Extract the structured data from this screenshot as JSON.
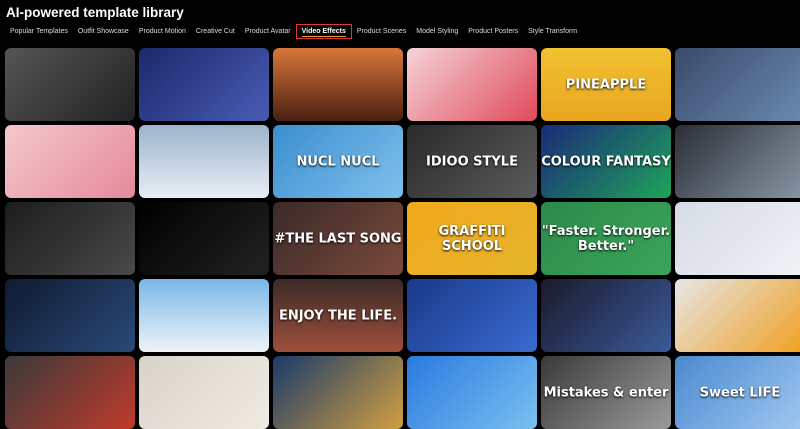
{
  "header": {
    "title": "AI-powered template library"
  },
  "tabs": [
    {
      "label": "Popular Templates"
    },
    {
      "label": "Outfit Showcase"
    },
    {
      "label": "Product Motion"
    },
    {
      "label": "Creative Cut"
    },
    {
      "label": "Product Avatar"
    },
    {
      "label": "Video Effects",
      "active": true
    },
    {
      "label": "Product Scenes"
    },
    {
      "label": "Model Styling"
    },
    {
      "label": "Product Posters"
    },
    {
      "label": "Style Transform"
    }
  ],
  "cards": [
    {
      "bg": "linear-gradient(135deg,#555,#222)",
      "text": ""
    },
    {
      "bg": "linear-gradient(135deg,#1b2a6b,#4a5bb5)",
      "text": ""
    },
    {
      "bg": "linear-gradient(180deg,#d9773a,#4b1f10)",
      "text": ""
    },
    {
      "bg": "linear-gradient(135deg,#f5d3d8,#e04a5a)",
      "text": ""
    },
    {
      "bg": "linear-gradient(180deg,#f2c230,#e9a520)",
      "text": "PINEAPPLE"
    },
    {
      "bg": "linear-gradient(135deg,#3a4a6a,#6a8ab0)",
      "text": ""
    },
    {
      "bg": "linear-gradient(135deg,#f4c7cc,#e58a9a)",
      "text": ""
    },
    {
      "bg": "linear-gradient(180deg,#9db4cc,#e8eef4)",
      "text": ""
    },
    {
      "bg": "linear-gradient(135deg,#3b8ed0,#7fc0ec)",
      "text": "NUCL NUCL"
    },
    {
      "bg": "linear-gradient(135deg,#2a2a2a,#5a5a5a)",
      "text": "IDIOO STYLE"
    },
    {
      "bg": "linear-gradient(135deg,#1a2a7a,#1fa35a)",
      "text": "COLOUR FANTASY"
    },
    {
      "bg": "linear-gradient(135deg,#2a2e36,#8a96a6)",
      "text": ""
    },
    {
      "bg": "linear-gradient(135deg,#1c1c1c,#4a4a4a)",
      "text": ""
    },
    {
      "bg": "linear-gradient(135deg,#000,#222)",
      "text": ""
    },
    {
      "bg": "linear-gradient(135deg,#3a2a2a,#7a4a3a)",
      "text": "#THE LAST SONG"
    },
    {
      "bg": "linear-gradient(135deg,#f2a81c,#e4b42a)",
      "text": "GRAFFITI SCHOOL"
    },
    {
      "bg": "linear-gradient(135deg,#2b8a4a,#3aa55a)",
      "text": "\"Faster. Stronger. Better.\""
    },
    {
      "bg": "linear-gradient(135deg,#d6dce4,#f0f2f6)",
      "text": ""
    },
    {
      "bg": "linear-gradient(135deg,#0e1a30,#2a4a78)",
      "text": ""
    },
    {
      "bg": "linear-gradient(180deg,#7ab6e8,#f0f4f8)",
      "text": ""
    },
    {
      "bg": "linear-gradient(180deg,#3a2a28,#a0503a)",
      "text": "ENJOY THE LIFE."
    },
    {
      "bg": "linear-gradient(135deg,#1a3a8a,#3a6ad0)",
      "text": ""
    },
    {
      "bg": "linear-gradient(135deg,#1a1a2a,#3a5a9a)",
      "text": ""
    },
    {
      "bg": "linear-gradient(135deg,#e6e6e6,#f0a020)",
      "text": ""
    },
    {
      "bg": "linear-gradient(135deg,#3a3a3a,#c03a2a)",
      "text": ""
    },
    {
      "bg": "linear-gradient(135deg,#d8d4cc,#f0ece4)",
      "text": ""
    },
    {
      "bg": "linear-gradient(135deg,#1a3a6a,#d0a040)",
      "text": ""
    },
    {
      "bg": "linear-gradient(135deg,#2a7ae0,#7ac0f0)",
      "text": ""
    },
    {
      "bg": "linear-gradient(135deg,#3a3a3a,#9a9a9a)",
      "text": "Mistakes & enter"
    },
    {
      "bg": "linear-gradient(135deg,#4a8ad0,#a0c8f0)",
      "text": "Sweet LIFE"
    }
  ]
}
